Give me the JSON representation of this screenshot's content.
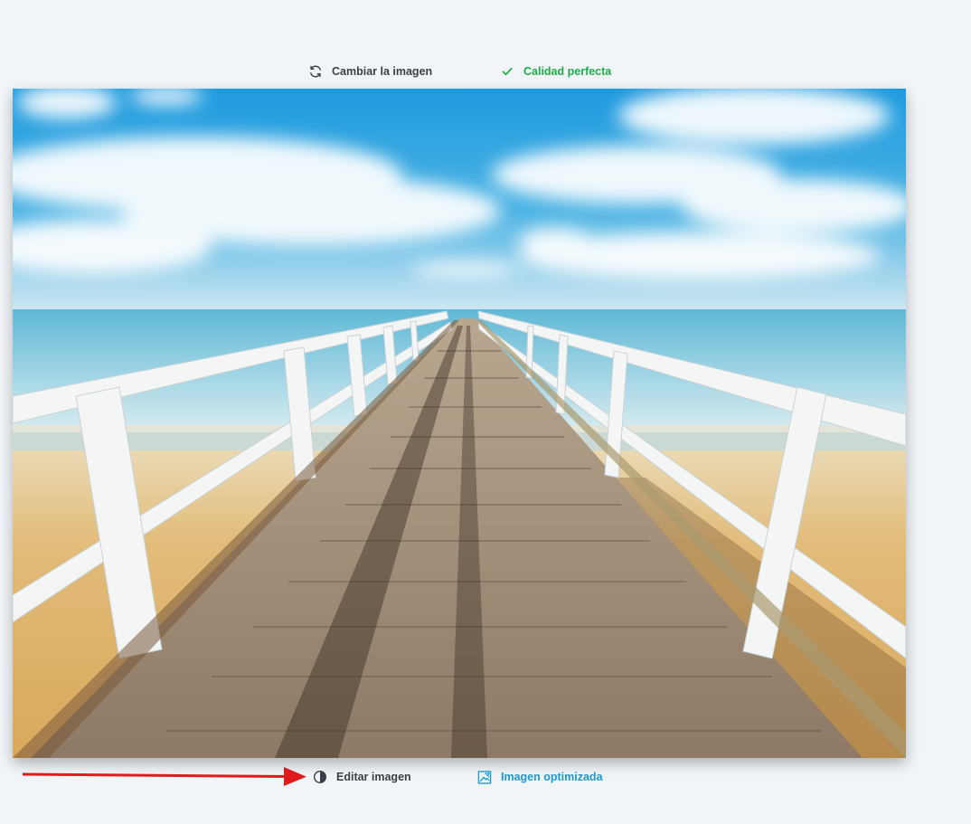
{
  "toolbar_top": {
    "change_image_label": "Cambiar la imagen",
    "change_image_icon": "refresh-icon",
    "quality_label": "Calidad perfecta",
    "quality_icon": "checkmark-icon",
    "quality_color": "#1fae4a"
  },
  "photo": {
    "subject": "pier-photo"
  },
  "toolbar_bottom": {
    "edit_image_label": "Editar imagen",
    "edit_image_icon": "contrast-icon",
    "optimized_label": "Imagen optimizada",
    "optimized_icon": "image-optimize-icon",
    "optimized_color": "#1a9ad6"
  },
  "annotation": {
    "arrow_color": "#e01b1b"
  }
}
